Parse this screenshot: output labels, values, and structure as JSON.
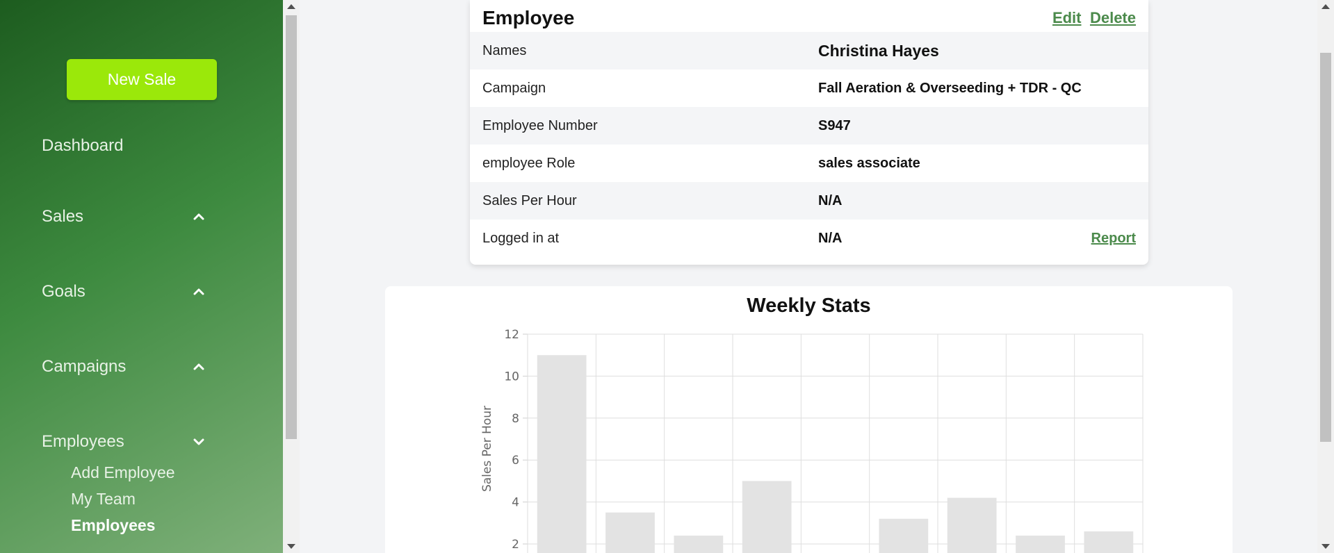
{
  "sidebar": {
    "new_sale": "New Sale",
    "dashboard": "Dashboard",
    "sales": "Sales",
    "goals": "Goals",
    "campaigns": "Campaigns",
    "employees": "Employees",
    "sub_items": [
      "Add Employee",
      "My Team",
      "Employees"
    ]
  },
  "employee": {
    "title": "Employee",
    "edit": "Edit",
    "delete": "Delete",
    "rows": [
      {
        "label": "Names",
        "value": "Christina Hayes"
      },
      {
        "label": "Campaign",
        "value": "Fall Aeration & Overseeding + TDR - QC"
      },
      {
        "label": "Employee Number",
        "value": "S947"
      },
      {
        "label": "employee Role",
        "value": "sales associate"
      },
      {
        "label": "Sales Per Hour",
        "value": "N/A"
      },
      {
        "label": "Logged in at",
        "value": "N/A",
        "link": "Report"
      }
    ]
  },
  "chart_data": {
    "type": "bar",
    "title": "Weekly Stats",
    "ylabel": "Sales Per Hour",
    "xlabel": "",
    "ylim": [
      0,
      12
    ],
    "yticks": [
      2,
      4,
      6,
      8,
      10,
      12
    ],
    "values": [
      11,
      3.5,
      2.4,
      5,
      0,
      3.2,
      4.2,
      2.4,
      2.6
    ],
    "grid": true,
    "bar_color": "#e3e3e3"
  }
}
